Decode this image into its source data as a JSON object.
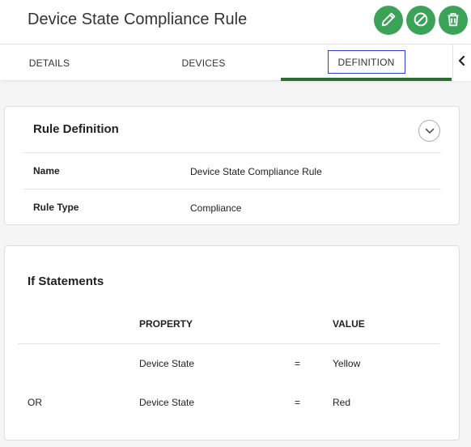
{
  "header": {
    "title": "Device State Compliance Rule",
    "actions": [
      {
        "name": "edit",
        "icon": "pencil-icon"
      },
      {
        "name": "disable",
        "icon": "block-icon"
      },
      {
        "name": "delete",
        "icon": "trash-icon"
      }
    ],
    "action_color": "#3aa357"
  },
  "tabs": {
    "items": [
      {
        "label": "DETAILS",
        "active": false
      },
      {
        "label": "DEVICES",
        "active": false
      },
      {
        "label": "DEFINITION",
        "active": true
      }
    ],
    "scroll_icon": "chevron-left-icon",
    "active_underline_color": "#2e6b35",
    "focus_outline_color": "#2a3fd1"
  },
  "rule_definition": {
    "title": "Rule Definition",
    "collapse_icon": "chevron-down-icon",
    "fields": [
      {
        "label": "Name",
        "value": "Device State Compliance Rule"
      },
      {
        "label": "Rule Type",
        "value": "Compliance"
      }
    ]
  },
  "if_statements": {
    "title": "If Statements",
    "columns": {
      "property": "PROPERTY",
      "value": "VALUE"
    },
    "rows": [
      {
        "connector": "",
        "property": "Device State",
        "operator": "=",
        "value": "Yellow"
      },
      {
        "connector": "OR",
        "property": "Device State",
        "operator": "=",
        "value": "Red"
      }
    ]
  }
}
